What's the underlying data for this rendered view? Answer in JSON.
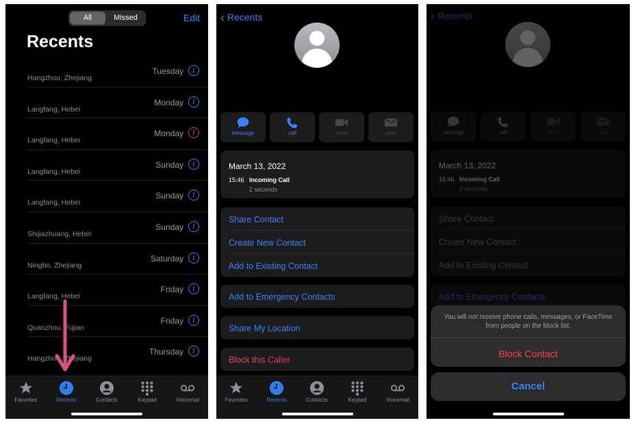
{
  "panel1": {
    "segmented": {
      "all": "All",
      "missed": "Missed"
    },
    "edit": "Edit",
    "title": "Recents",
    "calls": [
      {
        "location": "Hangzhou, Zhejiang",
        "day": "Tuesday",
        "missed": false
      },
      {
        "location": "Langfang, Hebei",
        "day": "Monday",
        "missed": false
      },
      {
        "location": "Langfang, Hebei",
        "day": "Monday",
        "missed": true
      },
      {
        "location": "Langfang, Hebei",
        "day": "Sunday",
        "missed": false
      },
      {
        "location": "Langfang, Hebei",
        "day": "Sunday",
        "missed": false
      },
      {
        "location": "Shijiazhuang, Hebei",
        "day": "Sunday",
        "missed": false
      },
      {
        "location": "Ningbo, Zhejiang",
        "day": "Saturday",
        "missed": false
      },
      {
        "location": "Langfang, Hebei",
        "day": "Friday",
        "missed": false
      },
      {
        "location": "Quanzhou, Fujian",
        "day": "Friday",
        "missed": false
      },
      {
        "location": "Hangzhou, Zhejiang",
        "day": "Thursday",
        "missed": false
      }
    ]
  },
  "tabbar": {
    "favorites": "Favorites",
    "recents": "Recents",
    "contacts": "Contacts",
    "keypad": "Keypad",
    "voicemail": "Voicemail"
  },
  "panel2": {
    "back": "Recents",
    "actions": {
      "message": "message",
      "call": "call",
      "video": "video",
      "mail": "mail"
    },
    "call_log": {
      "date": "March 13, 2022",
      "time": "15:46",
      "type": "Incoming Call",
      "duration": "2 seconds"
    },
    "share_contact": "Share Contact",
    "create_new_contact": "Create New Contact",
    "add_existing": "Add to Existing Contact",
    "add_emergency": "Add to Emergency Contacts",
    "share_location": "Share My Location",
    "block_caller": "Block this Caller"
  },
  "panel3": {
    "back": "Recents",
    "actions": {
      "message": "message",
      "call": "call",
      "video": "video",
      "mail": "mail"
    },
    "call_log": {
      "date": "March 13, 2022",
      "time": "15:46",
      "type": "Incoming Call",
      "duration": "2 seconds"
    },
    "share_contact": "Share Contact",
    "create_new_contact": "Create New Contact",
    "add_existing": "Add to Existing Contact",
    "add_emergency": "Add to Emergency Contacts",
    "sheet_message": "You will not receive phone calls, messages, or FaceTime from people on the block list.",
    "block_contact": "Block Contact",
    "cancel": "Cancel"
  },
  "colors": {
    "accent": "#3b82f6",
    "destructive": "#e0445a",
    "annotation_arrow": "#d9547a"
  }
}
